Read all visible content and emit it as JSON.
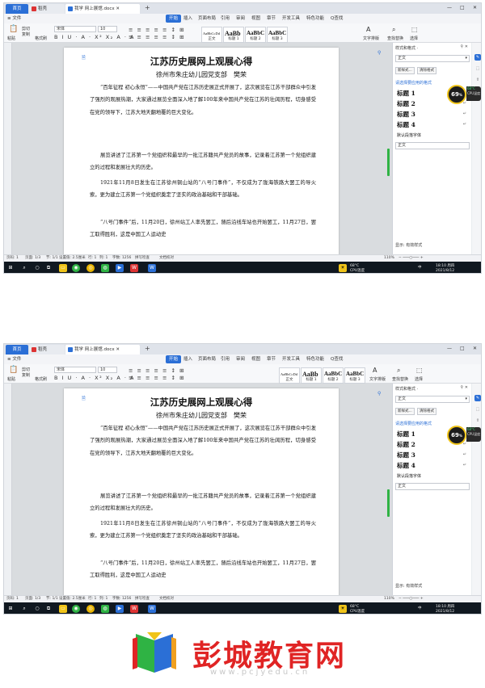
{
  "tabs": {
    "home": "首页",
    "wps": "稻壳",
    "doc": "我学 网上展馆.docx",
    "plus": "+"
  },
  "window_controls": {
    "min": "—",
    "max": "□",
    "close": "✕"
  },
  "menu": {
    "file": "≡ 文件",
    "items": [
      "开始",
      "插入",
      "页面布局",
      "引用",
      "审阅",
      "视图",
      "章节",
      "开发工具",
      "特色功能"
    ],
    "search": "Q查找"
  },
  "ribbon": {
    "paste": "粘贴",
    "cut": "剪切",
    "copy": "复制",
    "format_painter": "格式刷",
    "font_name": "宋体",
    "font_size": "10",
    "format_row": "B I U · A · X² X₂ A · A",
    "para_row": "≡ ≡ ≡ ≡ ≡ ↕ ⊞",
    "styles": [
      {
        "preview": "AaBbCcDd",
        "label": "正文"
      },
      {
        "preview": "AaBb",
        "label": "标题 1"
      },
      {
        "preview": "AaBbC",
        "label": "标题 2"
      },
      {
        "preview": "AaBbC",
        "label": "标题 3"
      }
    ],
    "text_tools": "文字排版",
    "find_replace": "查找替换",
    "select": "选择"
  },
  "document": {
    "title": "江苏历史展网上观展心得",
    "subtitle": "徐州市朱庄幼儿园党支部　樊荣",
    "paragraphs": [
      "“百年征程 初心永恒”——中国共产党在江苏历史展正式开展了，这次展览在江苏干部群众中引发了强烈的观展热潮，大家通过展览全面深入地了解100年来中国共产党在江苏的壮阔历程，切身感受在党的领导下，江苏大地天翻地覆的巨大变化。",
      "展览讲述了江苏第一个党组织和最早的一批江苏籍共产党员的故事，记录着江苏第一个党组织建立的过程和发展壮大的历史。",
      "1921年11月8日发生在江苏徐州铜山站的“八号门事件”，不仅成为了陇海铁路大罢工的导火索，更为建立江苏第一个党组织奠定了坚实的政治基础和干部基础。",
      "“八号门事件”后，11月20日，徐州站工人率先罢工，随后沿线车站也开始罢工，11月27日，罢工取得胜利，这是中国工人运动史"
    ]
  },
  "style_panel": {
    "title": "样式和格式 ·",
    "current": "正文",
    "new_style": "新样式...",
    "clear_format": "清除格式",
    "hint": "请选择要应用的格式",
    "styles": [
      "标题 1",
      "标题 2",
      "标题 3",
      "标题 4"
    ],
    "default_font": "默认段落字体",
    "body": "正文",
    "show_label": "显示: 有效样式",
    "return_mark": "↵"
  },
  "cpu": {
    "value": "69",
    "unit": "%",
    "temp": "68°C",
    "label": "CPU温度"
  },
  "status": {
    "page": "页码: 1",
    "pages": "页面: 1/3",
    "section": "节: 1/1",
    "setting": "设置值: 2.5厘米",
    "row": "行: 1",
    "col": "列: 1",
    "words": "字数: 1256",
    "spell": "拼写检查",
    "doc_check": "文档校对",
    "zoom": "110%"
  },
  "taskbar": {
    "temp": "68°C",
    "cpu_label": "CPU温度",
    "time": "18:10 周四",
    "date": "2021/8/12",
    "ime": "中"
  },
  "logo": {
    "text": "彭城教育网",
    "url": "www.pcjyedu.cn"
  },
  "colors": {
    "accent": "#2b6fd6",
    "logo_red": "#e02424",
    "scroll_green": "#2fb344"
  }
}
